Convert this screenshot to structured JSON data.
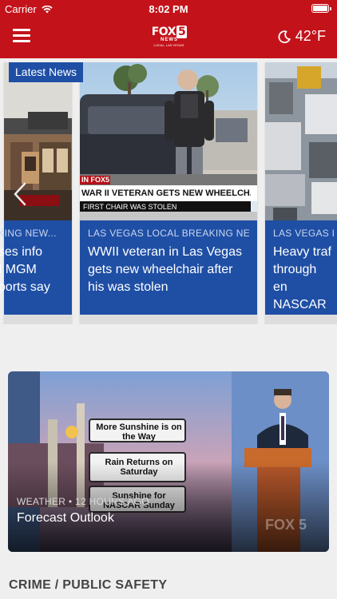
{
  "status": {
    "carrier": "Carrier",
    "time": "8:02 PM"
  },
  "nav": {
    "logo": {
      "main": "FOX",
      "number": "5",
      "sub": "NEWS",
      "tagline": "LOCAL. LAS VEGAS."
    },
    "weather": {
      "temp": "42°F",
      "icon": "moon-icon"
    }
  },
  "carousel": {
    "badge": "Latest News",
    "items": [
      {
        "category": "AKING NEW...",
        "title": "oses info\nM MGM\neports say"
      },
      {
        "category": "LAS VEGAS LOCAL BREAKING NEW...",
        "title": "WWII veteran in Las Vegas gets new wheelchair after his was stolen",
        "image_caption_main": "WAR II VETERAN GETS NEW WHEELCHAIR",
        "image_caption_sub": "FIRST CHAIR WAS STOLEN",
        "image_channel": "IN FOX5"
      },
      {
        "category": "LAS VEGAS LOC",
        "title": "Heavy traf\nthrough en\nNASCAR w"
      }
    ]
  },
  "video": {
    "category": "WEATHER • 12 HOURS AGO",
    "title": "Forecast Outlook",
    "board": [
      "More Sunshine is on the Way",
      "Rain Returns on Saturday",
      "Sunshine for NASCAR Sunday"
    ],
    "watermark": "FOX 5"
  },
  "section": {
    "title": "CRIME / PUBLIC SAFETY"
  },
  "colors": {
    "brand_red": "#c4121a",
    "card_blue": "#1f4fa5"
  }
}
